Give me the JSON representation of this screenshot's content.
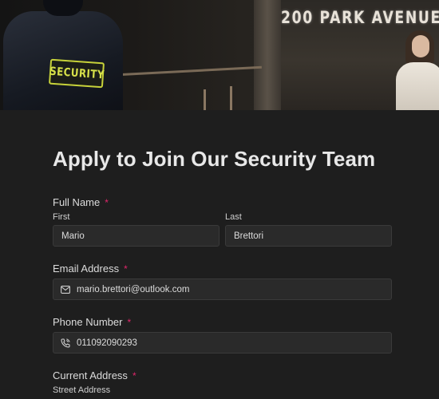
{
  "hero": {
    "sign_text": "200 PARK AVENUE",
    "patch_text": "SECURITY"
  },
  "form": {
    "title": "Apply to Join Our Security Team",
    "required_mark": "*",
    "full_name": {
      "label": "Full Name",
      "first_label": "First",
      "first_value": "Mario",
      "last_label": "Last",
      "last_value": "Brettori"
    },
    "email": {
      "label": "Email Address",
      "value": "mario.brettori@outlook.com",
      "icon": "mail-icon"
    },
    "phone": {
      "label": "Phone Number",
      "value": "011092090293",
      "icon": "phone-icon"
    },
    "address": {
      "label": "Current Address",
      "street_label": "Street Address"
    }
  },
  "colors": {
    "background": "#1e1e1e",
    "input_background": "#2a2a2a",
    "required": "#e0266b"
  }
}
